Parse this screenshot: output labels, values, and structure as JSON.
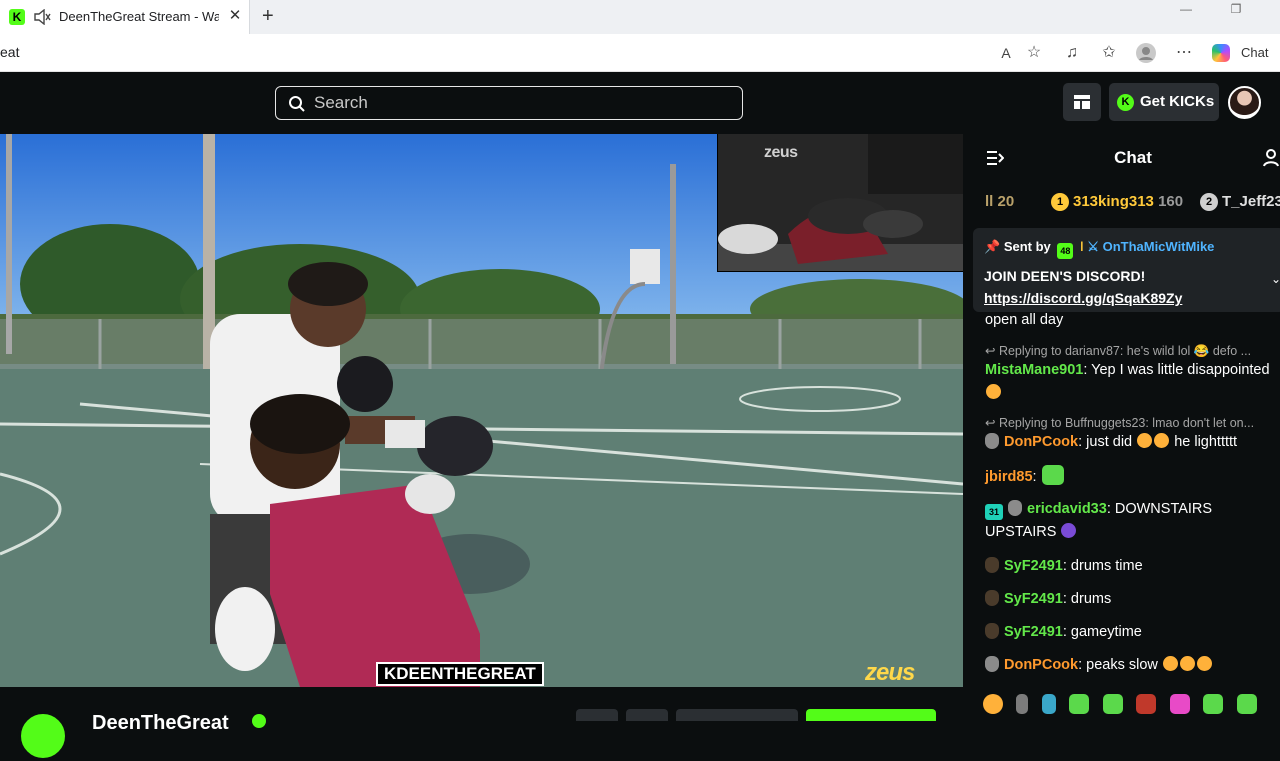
{
  "browser": {
    "tab_title": "DeenTheGreat Stream - Watch",
    "url_fragment": "eat",
    "copilot_label": "Chat"
  },
  "site": {
    "search_placeholder": "Search",
    "get_kicks_label": "Get KICKs"
  },
  "video": {
    "watermark_pip": "zeus",
    "watermark_corner": "zeus",
    "channel_overlay": "KDEENTHEGREAT"
  },
  "channel": {
    "name": "DeenTheGreat"
  },
  "chat": {
    "title": "Chat",
    "leaderboard": [
      {
        "rank": "",
        "name": "",
        "count": "20"
      },
      {
        "rank": "1",
        "name": "313king313",
        "count": "160"
      },
      {
        "rank": "2",
        "name": "T_Jeff23",
        "count": ""
      }
    ],
    "pinned": {
      "sent_by_label": "Sent by",
      "badge": "48",
      "user": "OnThaMicWitMike",
      "message": "JOIN DEEN'S DISCORD!",
      "link": "https://discord.gg/qSqaK89Zy"
    },
    "messages": [
      {
        "text": "open all day"
      },
      {
        "reply": "Replying to darianv87: he's wild lol 😂 defo ..."
      },
      {
        "user": "MistaMane901",
        "text": "Yep I was little disappointed"
      },
      {
        "reply": "Replying to Buffnuggets23: lmao don't let on..."
      },
      {
        "user": "DonPCook",
        "text": "just did",
        "text2": "he lighttttt"
      },
      {
        "user": "jbird85",
        "text": ""
      },
      {
        "badge": "31",
        "user": "ericdavid33",
        "text": "DOWNSTAIRS UPSTAIRS"
      },
      {
        "user": "SyF2491",
        "text": "drums time"
      },
      {
        "user": "SyF2491",
        "text": "drums"
      },
      {
        "user": "SyF2491",
        "text": "gameytime"
      },
      {
        "user": "DonPCook",
        "text": "peaks slow"
      }
    ]
  },
  "colors": {
    "kick_green": "#53fc18",
    "gold": "#ffc93a",
    "link_blue": "#4fb4ff",
    "user_green": "#63e84a",
    "user_orange": "#ff9a2e"
  }
}
